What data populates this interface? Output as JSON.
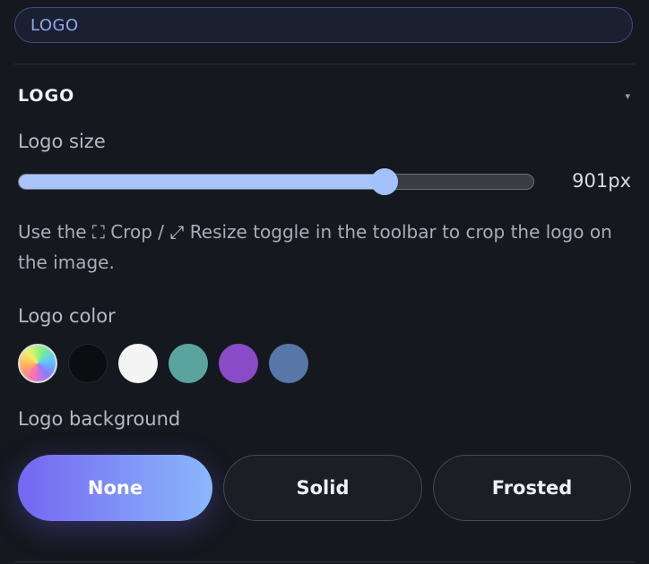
{
  "search": {
    "value": "LOGO"
  },
  "section": {
    "title": "LOGO",
    "caret_icon": "▾"
  },
  "logo_size": {
    "label": "Logo size",
    "value_text": "901px",
    "level_fraction": 0.71
  },
  "hint": {
    "prefix": "Use the ",
    "crop_icon": "⛶",
    "crop_label": " Crop / ",
    "resize_icon": "⤢",
    "suffix": " Resize toggle in the toolbar to crop the logo on the image."
  },
  "logo_color": {
    "label": "Logo color",
    "swatches": [
      {
        "name": "gradient",
        "color": "rainbow"
      },
      {
        "name": "black",
        "color": "#0b0d11"
      },
      {
        "name": "white",
        "color": "#f4f4f5"
      },
      {
        "name": "teal",
        "color": "#5aa39f"
      },
      {
        "name": "purple",
        "color": "#8a4bc6"
      },
      {
        "name": "blue",
        "color": "#5677a8"
      }
    ]
  },
  "logo_background": {
    "label": "Logo background",
    "options": [
      "None",
      "Solid",
      "Frosted"
    ],
    "selected": "None"
  }
}
